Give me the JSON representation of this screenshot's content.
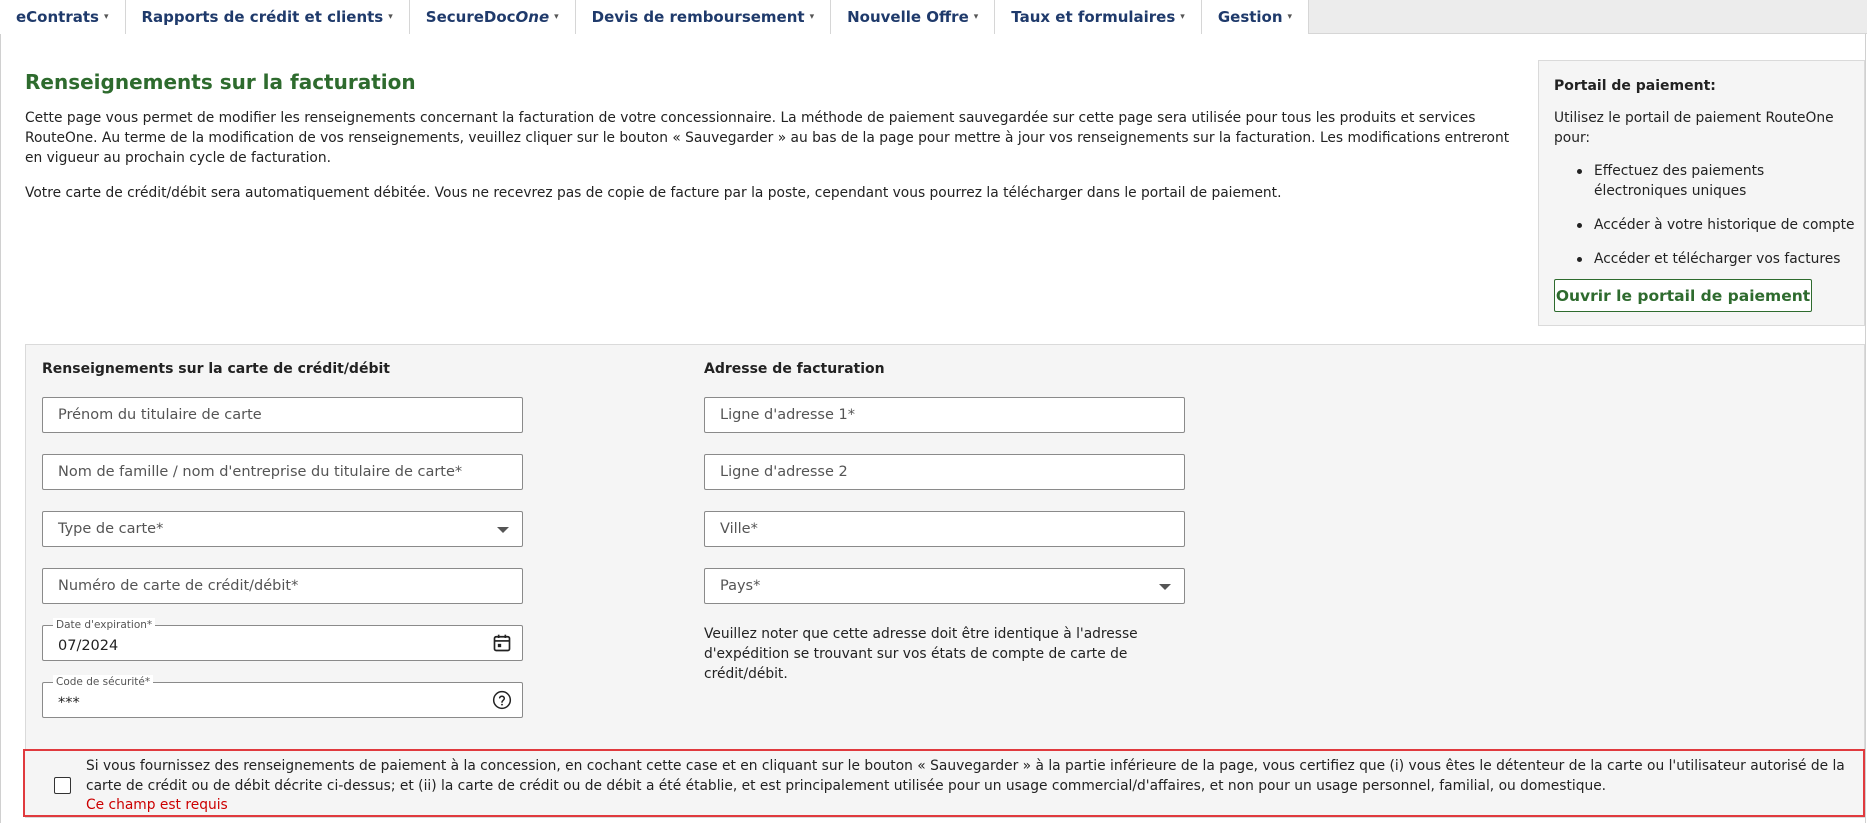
{
  "nav": {
    "tabs": [
      {
        "label": "eContrats"
      },
      {
        "label": "Rapports de crédit et clients"
      },
      {
        "label_main": "SecureDoc",
        "label_italic": "One"
      },
      {
        "label": "Devis de remboursement"
      },
      {
        "label": "Nouvelle Offre"
      },
      {
        "label": "Taux et formulaires"
      },
      {
        "label": "Gestion"
      }
    ],
    "caret": "▾"
  },
  "page": {
    "title": "Renseignements sur la facturation",
    "intro": "Cette page vous permet de modifier les renseignements concernant la facturation de votre concessionnaire. La méthode de paiement sauvegardée sur cette page sera utilisée pour tous les produits et services RouteOne. Au terme de la modification de vos renseignements, veuillez cliquer sur le bouton « Sauvegarder » au bas de la page pour mettre à jour vos renseignements sur la facturation. Les modifications entreront en vigueur au prochain cycle de facturation.",
    "intro2": "Votre carte de crédit/débit sera automatiquement débitée. Vous ne recevrez pas de copie de facture par la poste, cependant vous pourrez la télécharger dans le portail de paiement."
  },
  "portal": {
    "title": "Portail de paiement:",
    "text": "Utilisez le portail de paiement RouteOne pour:",
    "items": [
      "Effectuez des paiements électroniques uniques",
      "Accéder à votre historique de compte",
      "Accéder et télécharger vos factures"
    ],
    "button": "Ouvrir le portail de paiement"
  },
  "card": {
    "title": "Renseignements sur la carte de crédit/débit",
    "first_name": "Prénom du titulaire de carte",
    "last_name": "Nom de famille / nom d'entreprise du titulaire de carte*",
    "card_type": "Type de carte*",
    "card_number": "Numéro de carte de crédit/débit*",
    "expiry_label": "Date d'expiration*",
    "expiry_value": "07/2024",
    "security_label": "Code de sécurité*",
    "security_value": "***"
  },
  "address": {
    "title": "Adresse de facturation",
    "line1": "Ligne d'adresse 1*",
    "line2": "Ligne d'adresse 2",
    "city": "Ville*",
    "country": "Pays*",
    "note": "Veuillez noter que cette adresse doit être identique à l'adresse d'expédition se trouvant sur vos états de compte de carte de crédit/débit."
  },
  "certification": {
    "text": "Si vous fournissez des renseignements de paiement à la concession, en cochant cette case et en cliquant sur le bouton « Sauvegarder » à la partie inférieure de la page, vous certifiez que (i) vous êtes le détenteur de la carte ou l'utilisateur autorisé de la carte de crédit ou de débit décrite ci-dessus; et (ii) la carte de crédit ou de débit a été établie, et est principalement utilisée pour un usage commercial/d'affaires, et non pour un usage personnel, familial, ou domestique.",
    "error": "Ce champ est requis"
  },
  "colors": {
    "nav_text": "#1f3a6b",
    "title_green": "#2e6b2e",
    "error_red": "#cc0000",
    "highlight_border": "#e03a3e"
  },
  "icons": {
    "calendar": "calendar-icon",
    "help": "help-circle-icon",
    "dropdown": "chevron-down-icon"
  }
}
